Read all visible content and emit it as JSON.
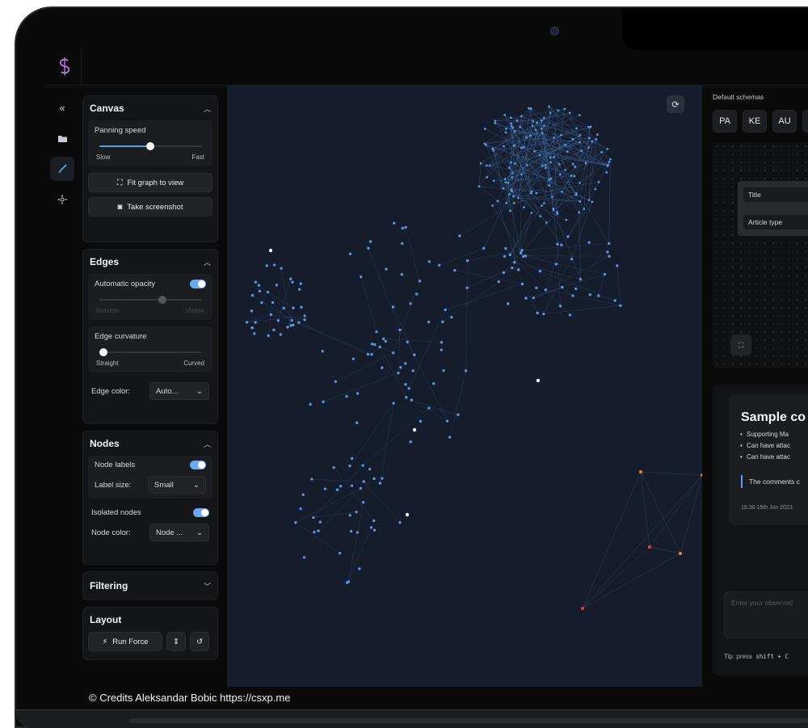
{
  "sidebar": {
    "canvas": {
      "title": "Canvas",
      "panning_label": "Panning speed",
      "panning_value": 0.5,
      "panning_min": "Slow",
      "panning_max": "Fast",
      "fit_label": "Fit graph to view",
      "screenshot_label": "Take screenshot"
    },
    "edges": {
      "title": "Edges",
      "auto_opacity_label": "Automatic opacity",
      "auto_opacity_on": true,
      "opacity_min": "Invisible",
      "opacity_max": "Visible",
      "curvature_label": "Edge curvature",
      "curvature_value": 0,
      "curvature_min": "Straight",
      "curvature_max": "Curved",
      "color_label": "Edge color:",
      "color_value": "Auto..."
    },
    "nodes": {
      "title": "Nodes",
      "labels_label": "Node labels",
      "labels_on": true,
      "label_size_label": "Label size:",
      "label_size_value": "Small",
      "isolated_label": "Isolated nodes",
      "isolated_on": true,
      "node_color_label": "Node color:",
      "node_color_value": "Node ..."
    },
    "filtering": {
      "title": "Filtering"
    },
    "layout": {
      "title": "Layout",
      "run_label": "Run Force"
    }
  },
  "right_panel": {
    "schemas_label": "Default schemas",
    "schemas": [
      "PA",
      "KE",
      "AU"
    ],
    "fields": [
      "Title",
      "Article type"
    ],
    "comment": {
      "title": "Sample co",
      "bullets": [
        "Supporting Ma",
        "Can have attac",
        "Can have attac"
      ],
      "quote": "The comments c",
      "timestamp": "15:30 15th Jun 2023"
    },
    "observation_placeholder": "Enter your observati",
    "tip_label": "Tip: press",
    "tip_keys": "shift + C"
  },
  "colors": {
    "accent": "#5b9cf0",
    "graph_bg": "#151c2b",
    "node": "#5c95da",
    "highlight_orange": "#e0873a",
    "highlight_red": "#e04a3a"
  },
  "credits": "© Credits Aleksandar Bobic https://csxp.me"
}
